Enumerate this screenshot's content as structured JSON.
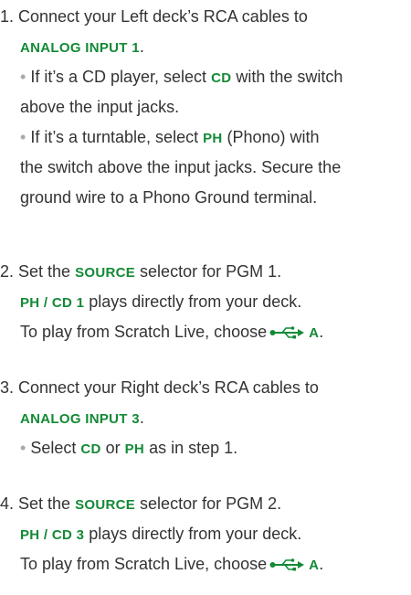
{
  "accent_color": "#138a36",
  "step1": {
    "l1": "1. Connect your Left deck’s RCA cables to",
    "l2_key": "ANALOG INPUT 1",
    "l2_end": ".",
    "bullet": "•",
    "l3_a": " If it’s a CD player, select ",
    "l3_key": "CD",
    "l3_b": " with the switch",
    "l4": "above the input jacks.",
    "l5_a": " If it’s a turntable, select ",
    "l5_key": "PH",
    "l5_b": " (Phono) with",
    "l6": "the switch above the input jacks. Secure the",
    "l7": "ground wire to a Phono Ground terminal."
  },
  "step2": {
    "l1_a": "2. Set the ",
    "l1_key": "SOURCE",
    "l1_b": " selector for PGM 1.",
    "l2_key": "PH / CD 1",
    "l2_b": " plays directly from your deck.",
    "l3_a": "To play from Scratch Live, choose",
    "l3_icon": "usb-icon",
    "l3_key": "A",
    "l3_end": "."
  },
  "step3": {
    "l1": "3. Connect your Right deck’s RCA cables to",
    "l2_key": "ANALOG INPUT 3",
    "l2_end": ".",
    "bullet": "•",
    "l3_a": " Select ",
    "l3_key1": "CD",
    "l3_mid": " or ",
    "l3_key2": "PH",
    "l3_b": " as in step 1."
  },
  "step4": {
    "l1_a": "4. Set the ",
    "l1_key": "SOURCE",
    "l1_b": " selector for PGM 2.",
    "l2_key": "PH / CD 3",
    "l2_b": " plays directly from your deck.",
    "l3_a": "To play from Scratch Live, choose",
    "l3_icon": "usb-icon",
    "l3_key": "A",
    "l3_end": "."
  }
}
